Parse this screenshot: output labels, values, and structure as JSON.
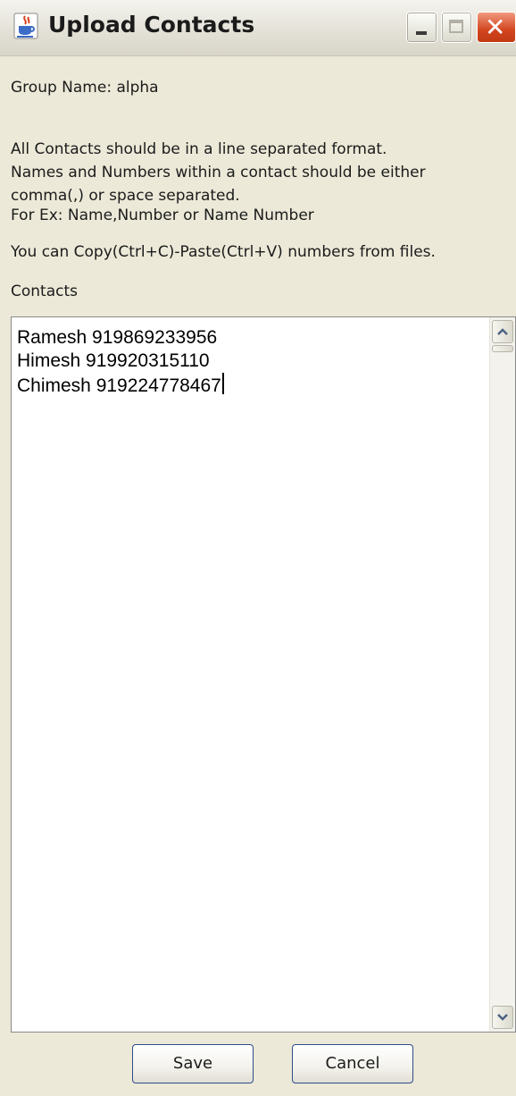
{
  "window": {
    "title": "Upload Contacts",
    "icon": "java-coffee-icon",
    "controls": {
      "minimize": "minimize-icon",
      "maximize": "maximize-icon",
      "close": "close-icon"
    }
  },
  "content": {
    "group_name": "Group Name: alpha",
    "instructions": [
      "All Contacts should be in a line separated format.",
      "Names and Numbers within a contact should be either",
      "comma(,) or space separated."
    ],
    "example": "For Ex: Name,Number or Name Number",
    "copy_paste_hint": "You can Copy(Ctrl+C)-Paste(Ctrl+V) numbers from files.",
    "contacts_label": "Contacts"
  },
  "contacts": {
    "lines": [
      "Ramesh 919869233956",
      "Himesh 919920315110",
      "Chimesh 919224778467"
    ]
  },
  "buttons": {
    "save": "Save",
    "cancel": "Cancel"
  },
  "colors": {
    "window_bg": "#ece9d8",
    "close_button": "#d2451f",
    "button_border": "#2e4d87"
  }
}
